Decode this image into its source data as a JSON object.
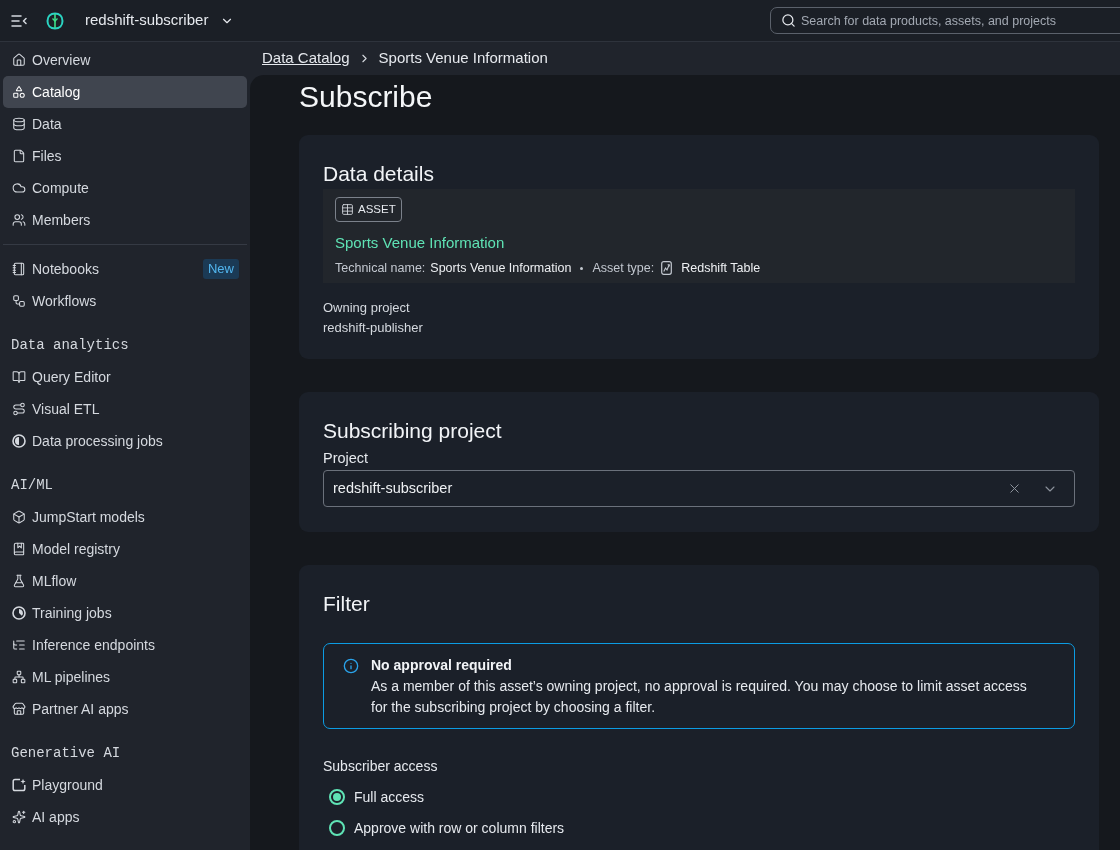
{
  "top_bar": {
    "project": "redshift-subscriber",
    "search": {
      "placeholder": "Search for data products, assets, and projects"
    }
  },
  "sidebar": {
    "sections": [
      {
        "items": [
          {
            "label": "Overview",
            "selected": false
          },
          {
            "label": "Catalog",
            "selected": true
          },
          {
            "label": "Data",
            "selected": false
          },
          {
            "label": "Files",
            "selected": false
          },
          {
            "label": "Compute",
            "selected": false
          },
          {
            "label": "Members",
            "selected": false
          }
        ]
      },
      {
        "items": [
          {
            "label": "Notebooks",
            "selected": false,
            "badge": "New"
          },
          {
            "label": "Workflows",
            "selected": false
          }
        ]
      },
      {
        "heading": "Data analytics",
        "items": [
          {
            "label": "Query Editor",
            "selected": false
          },
          {
            "label": "Visual ETL",
            "selected": false
          },
          {
            "label": "Data processing jobs",
            "selected": false
          }
        ]
      },
      {
        "heading": "AI/ML",
        "items": [
          {
            "label": "JumpStart models",
            "selected": false
          },
          {
            "label": "Model registry",
            "selected": false
          },
          {
            "label": "MLflow",
            "selected": false
          },
          {
            "label": "Training jobs",
            "selected": false
          },
          {
            "label": "Inference endpoints",
            "selected": false
          },
          {
            "label": "ML pipelines",
            "selected": false
          },
          {
            "label": "Partner AI apps",
            "selected": false
          }
        ]
      },
      {
        "heading": "Generative AI",
        "items": [
          {
            "label": "Playground",
            "selected": false
          },
          {
            "label": "AI apps",
            "selected": false
          }
        ]
      }
    ]
  },
  "breadcrumb": [
    {
      "label": "Data Catalog",
      "kind": "link"
    },
    {
      "label": "Sports Venue Information",
      "kind": "current"
    }
  ],
  "page_title": "Subscribe",
  "data_details": {
    "title": "Data details",
    "asset": {
      "badge": "ASSET",
      "name": "Sports Venue Information",
      "technical_name_label": "Technical name:",
      "technical_name": "Sports Venue Information",
      "asset_type_label": "Asset type:",
      "asset_type": "Redshift Table"
    },
    "owning_project": {
      "label": "Owning project",
      "value": "redshift-publisher"
    }
  },
  "subscribing_project": {
    "title": "Subscribing project",
    "field": {
      "label": "Project",
      "value": "redshift-subscriber"
    }
  },
  "filter": {
    "title": "Filter",
    "alert": {
      "title": "No approval required",
      "message": "As a member of this asset’s owning project, no approval is required. You may choose to limit asset access for the subscribing project by choosing a filter."
    },
    "access": {
      "label": "Subscriber access",
      "options": [
        {
          "label": "Full access",
          "selected": true
        },
        {
          "label": "Approve with row or column filters",
          "selected": false
        }
      ]
    }
  }
}
